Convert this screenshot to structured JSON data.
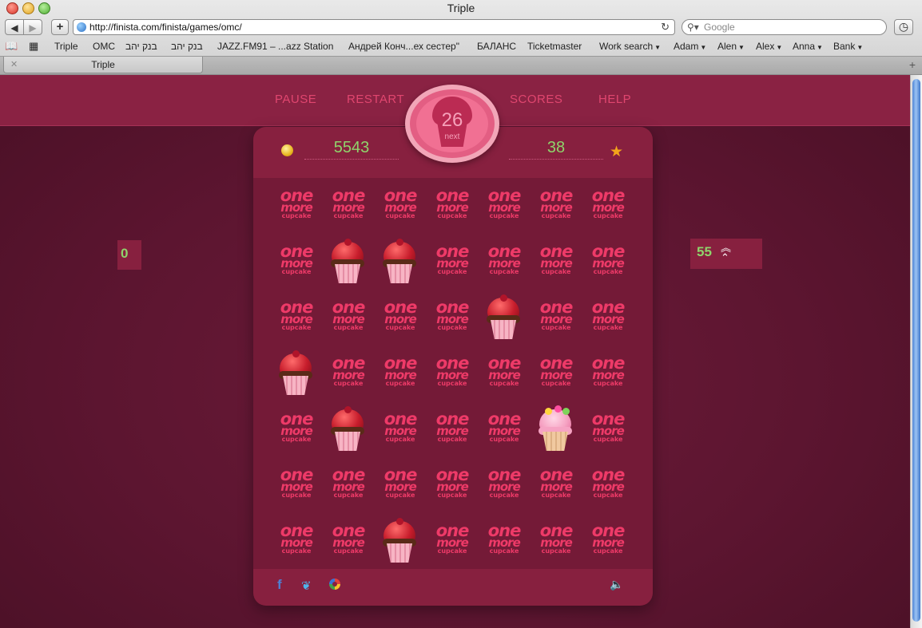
{
  "window": {
    "title": "Triple"
  },
  "toolbar": {
    "url": "http://finista.com/finista/games/omc/",
    "search_placeholder": "Google"
  },
  "bookmarks": [
    {
      "label": "Triple",
      "menu": false
    },
    {
      "label": "OMC",
      "menu": false
    },
    {
      "label": "בנק יהב",
      "menu": false
    },
    {
      "label": "בנק יהב",
      "menu": false
    },
    {
      "label": "JAZZ.FM91 – ...azz Station",
      "menu": false
    },
    {
      "label": "Андрей Конч...ех сестер\"",
      "menu": false
    },
    {
      "label": "БАЛАНС",
      "menu": false
    },
    {
      "label": "Ticketmaster",
      "menu": false
    },
    {
      "label": "Work search",
      "menu": true
    },
    {
      "label": "Adam",
      "menu": true
    },
    {
      "label": "Alen",
      "menu": true
    },
    {
      "label": "Alex",
      "menu": true
    },
    {
      "label": "Anna",
      "menu": true
    },
    {
      "label": "Bank",
      "menu": true
    }
  ],
  "tabs": [
    {
      "label": "Triple"
    }
  ],
  "menu": {
    "pause": "PAUSE",
    "restart": "RESTART",
    "scores": "SCORES",
    "help": "HELP"
  },
  "next_piece": {
    "count": "26",
    "label": "next"
  },
  "stats": {
    "score": "5543",
    "moves": "38"
  },
  "side": {
    "left_value": "0",
    "right_value": "55"
  },
  "logo_text": {
    "line1": "one",
    "line2": "more",
    "line3": "cupcake"
  },
  "icons": {
    "coin": "coin-icon",
    "star": "star-icon",
    "facebook": "facebook-icon",
    "twitter": "twitter-icon",
    "share": "share-icon",
    "sound": "speaker-icon",
    "rank": "chevrons-up-icon"
  },
  "colors": {
    "background": "#5e1630",
    "panel": "#87203f",
    "accent": "#e0466f",
    "value": "#8fd36b"
  },
  "board": {
    "rows": 7,
    "cols": 7,
    "cells": [
      [
        "logo",
        "logo",
        "logo",
        "logo",
        "logo",
        "logo",
        "logo"
      ],
      [
        "logo",
        "cupcake",
        "cupcake",
        "logo",
        "logo",
        "logo",
        "logo"
      ],
      [
        "logo",
        "logo",
        "logo",
        "logo",
        "cupcake",
        "logo",
        "logo"
      ],
      [
        "cupcake",
        "logo",
        "logo",
        "logo",
        "logo",
        "logo",
        "logo"
      ],
      [
        "logo",
        "cupcake",
        "logo",
        "logo",
        "logo",
        "special-cupcake",
        "logo"
      ],
      [
        "logo",
        "logo",
        "logo",
        "logo",
        "logo",
        "logo",
        "logo"
      ],
      [
        "logo",
        "logo",
        "cupcake",
        "logo",
        "logo",
        "logo",
        "logo"
      ]
    ]
  }
}
